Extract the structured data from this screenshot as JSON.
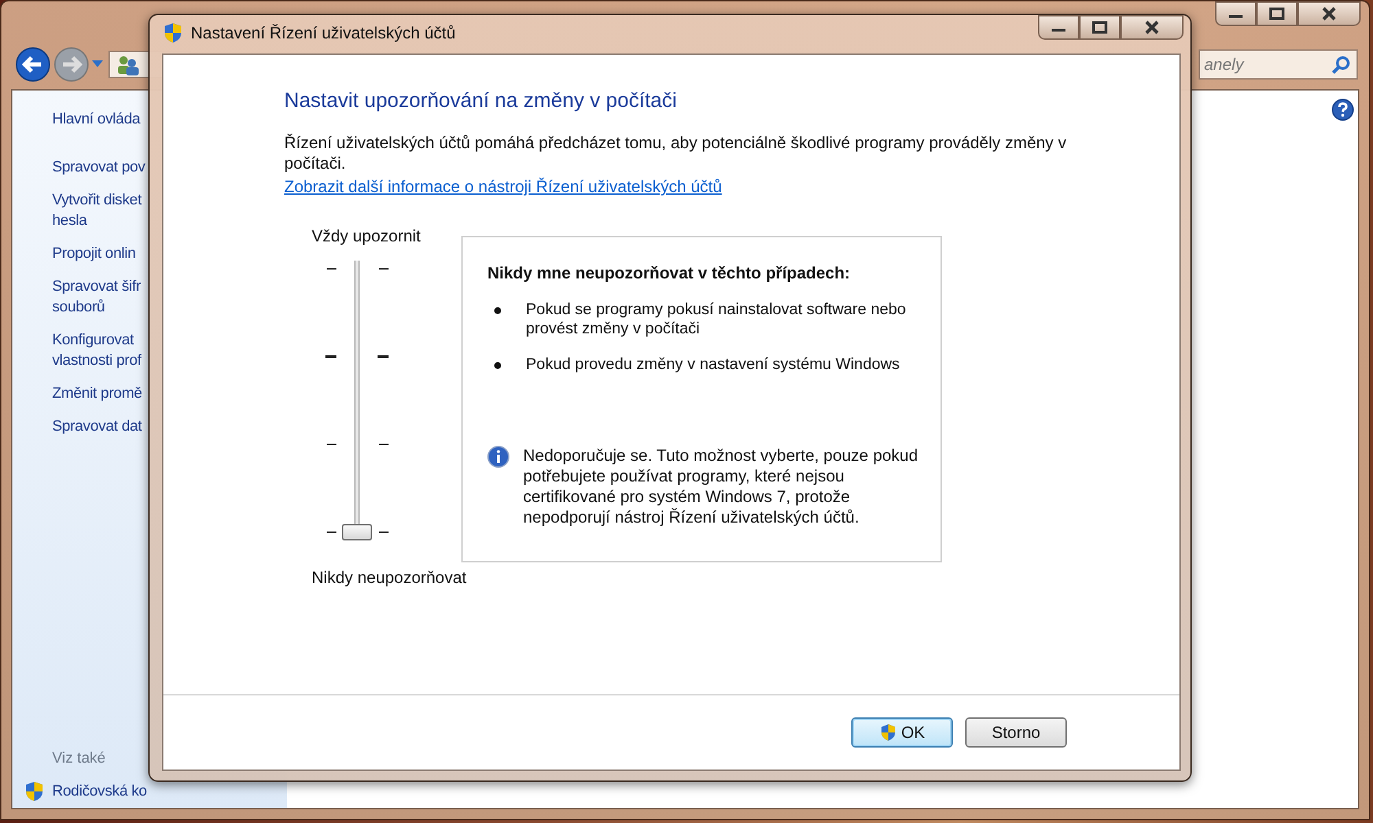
{
  "background_window": {
    "search": {
      "placeholder": "anely"
    },
    "sidebar": {
      "items": [
        {
          "lines": [
            "Hlavní ovláda"
          ]
        },
        {
          "lines": [
            "Spravovat pov"
          ]
        },
        {
          "lines": [
            "Vytvořit disket",
            "hesla"
          ]
        },
        {
          "lines": [
            "Propojit onlin"
          ]
        },
        {
          "lines": [
            "Spravovat šifr",
            "souborů"
          ]
        },
        {
          "lines": [
            "Konfigurovat",
            "vlastnosti prof"
          ]
        },
        {
          "lines": [
            "Změnit promě"
          ]
        },
        {
          "lines": [
            "Spravovat dat"
          ]
        }
      ],
      "see_also_title": "Viz také",
      "see_also": [
        {
          "label": "Rodičovská ko"
        }
      ]
    }
  },
  "dialog": {
    "title": "Nastavení Řízení uživatelských účtů",
    "heading": "Nastavit upozorňování na změny v počítači",
    "description": "Řízení uživatelských účtů pomáhá předcházet tomu, aby potenciálně škodlivé programy prováděly změny v počítači.",
    "link": "Zobrazit další informace o nástroji Řízení uživatelských účtů",
    "slider": {
      "top_label": "Vždy upozornit",
      "bottom_label": "Nikdy neupozorňovat",
      "level": 0
    },
    "info": {
      "title": "Nikdy mne neupozorňovat v těchto případech:",
      "bullets": [
        "Pokud se programy pokusí nainstalovat software nebo provést změny v počítači",
        "Pokud provedu změny v nastavení systému Windows"
      ],
      "note": "Nedoporučuje se. Tuto možnost vyberte, pouze pokud potřebujete používat programy, které nejsou certifikované pro systém Windows 7, protože nepodporují nástroj Řízení uživatelských účtů."
    },
    "buttons": [
      {
        "label": "OK",
        "kind": "default"
      },
      {
        "label": "Storno",
        "kind": "normal"
      }
    ]
  }
}
